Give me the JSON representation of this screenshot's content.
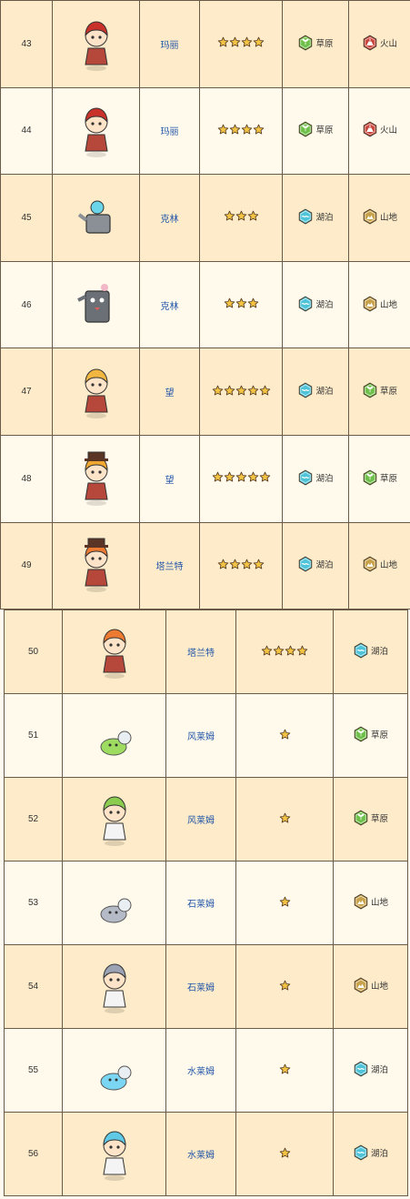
{
  "rows_a": [
    {
      "no": "43",
      "name": "玛丽",
      "stars": 4,
      "t1": {
        "label": "草原",
        "type": "grass"
      },
      "t2": {
        "label": "火山",
        "type": "volcano"
      },
      "char": "red-haired-girl"
    },
    {
      "no": "44",
      "name": "玛丽",
      "stars": 4,
      "t1": {
        "label": "草原",
        "type": "grass"
      },
      "t2": {
        "label": "火山",
        "type": "volcano"
      },
      "char": "red-haired-girl"
    },
    {
      "no": "45",
      "name": "克林",
      "stars": 3,
      "t1": {
        "label": "湖泊",
        "type": "lake"
      },
      "t2": {
        "label": "山地",
        "type": "mountain"
      },
      "char": "watering-can"
    },
    {
      "no": "46",
      "name": "克林",
      "stars": 3,
      "t1": {
        "label": "湖泊",
        "type": "lake"
      },
      "t2": {
        "label": "山地",
        "type": "mountain"
      },
      "char": "can-robot"
    },
    {
      "no": "47",
      "name": "望",
      "stars": 5,
      "t1": {
        "label": "湖泊",
        "type": "lake"
      },
      "t2": {
        "label": "草原",
        "type": "grass"
      },
      "char": "blonde-telescope"
    },
    {
      "no": "48",
      "name": "望",
      "stars": 5,
      "t1": {
        "label": "湖泊",
        "type": "lake"
      },
      "t2": {
        "label": "草原",
        "type": "grass"
      },
      "char": "blonde-hat"
    },
    {
      "no": "49",
      "name": "塔兰特",
      "stars": 4,
      "t1": {
        "label": "湖泊",
        "type": "lake"
      },
      "t2": {
        "label": "山地",
        "type": "mountain"
      },
      "char": "orange-haired-hat"
    }
  ],
  "rows_b": [
    {
      "no": "50",
      "name": "塔兰特",
      "stars": 4,
      "t1": {
        "label": "湖泊",
        "type": "lake"
      },
      "char": "orange-haired-boy"
    },
    {
      "no": "51",
      "name": "风莱姆",
      "stars": 1,
      "t1": {
        "label": "草原",
        "type": "grass"
      },
      "char": "green-slime"
    },
    {
      "no": "52",
      "name": "风莱姆",
      "stars": 1,
      "t1": {
        "label": "草原",
        "type": "grass"
      },
      "char": "green-slime-girl"
    },
    {
      "no": "53",
      "name": "石莱姆",
      "stars": 1,
      "t1": {
        "label": "山地",
        "type": "mountain"
      },
      "char": "gray-slime"
    },
    {
      "no": "54",
      "name": "石莱姆",
      "stars": 1,
      "t1": {
        "label": "山地",
        "type": "mountain"
      },
      "char": "gray-slime-girl"
    },
    {
      "no": "55",
      "name": "水莱姆",
      "stars": 1,
      "t1": {
        "label": "湖泊",
        "type": "lake"
      },
      "char": "blue-slime"
    },
    {
      "no": "56",
      "name": "水莱姆",
      "stars": 1,
      "t1": {
        "label": "湖泊",
        "type": "lake"
      },
      "char": "blue-slime-girl"
    }
  ],
  "colors": {
    "grass": "#6fc04a",
    "volcano": "#c9443a",
    "lake": "#4fc3d8",
    "mountain": "#c8a24a",
    "star": "#f3c443",
    "border": "#6a5a48",
    "odd": "#fdebc9",
    "even": "#fffaeb"
  }
}
